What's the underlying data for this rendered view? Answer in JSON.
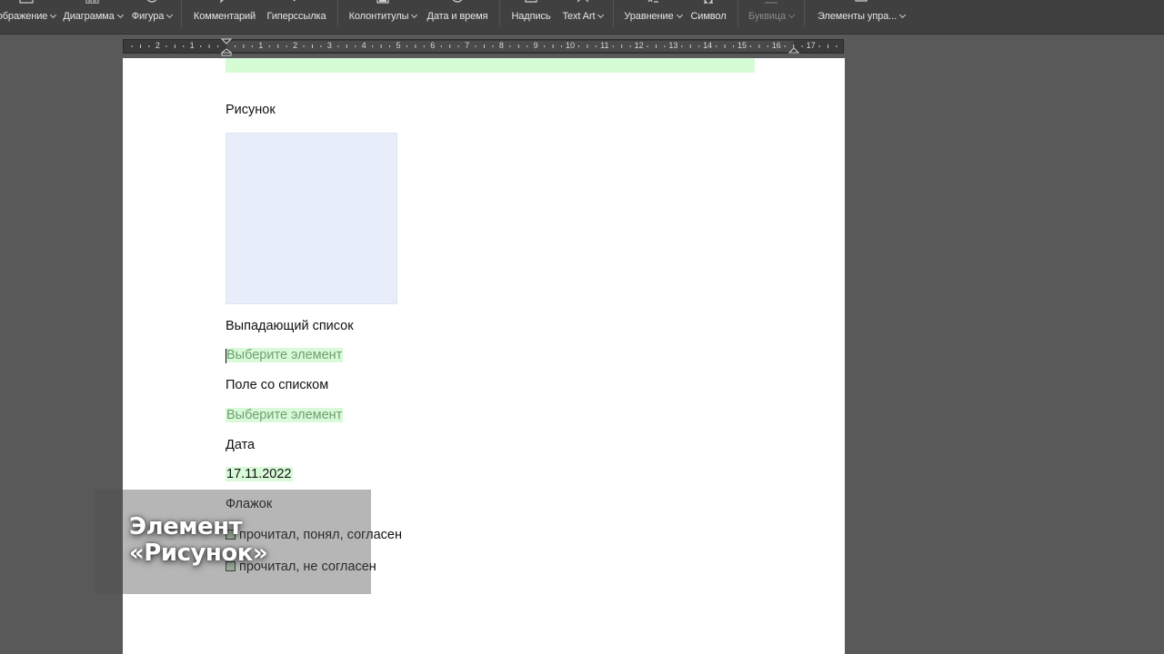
{
  "toolbar": {
    "items": [
      {
        "label": "ображение",
        "dropdown": true,
        "icon": "image-icon"
      },
      {
        "label": "Диаграмма",
        "dropdown": true,
        "icon": "chart-icon"
      },
      {
        "label": "Фигура",
        "dropdown": true,
        "icon": "shape-icon"
      },
      {
        "label": "Комментарий",
        "dropdown": false,
        "icon": "comment-icon"
      },
      {
        "label": "Гиперссылка",
        "dropdown": false,
        "icon": "hyperlink-icon"
      },
      {
        "label": "Колонтитулы",
        "dropdown": true,
        "icon": "header-footer-icon"
      },
      {
        "label": "Дата и время",
        "dropdown": false,
        "icon": "date-time-icon"
      },
      {
        "label": "Надпись",
        "dropdown": false,
        "icon": "text-box-icon"
      },
      {
        "label": "Text Art",
        "dropdown": true,
        "icon": "text-art-icon"
      },
      {
        "label": "Уравнение",
        "dropdown": true,
        "icon": "equation-icon"
      },
      {
        "label": "Символ",
        "dropdown": false,
        "icon": "symbol-icon"
      },
      {
        "label": "Буквица",
        "dropdown": true,
        "icon": "drop-cap-icon",
        "disabled": true
      },
      {
        "label": "Элементы упра...",
        "dropdown": true,
        "icon": "content-controls-icon"
      }
    ]
  },
  "ruler": {
    "numbers": [
      "2",
      "1",
      "1",
      "2",
      "3",
      "4",
      "5",
      "6",
      "7",
      "8",
      "9",
      "10",
      "11",
      "12",
      "13",
      "14",
      "15",
      "16",
      "17"
    ]
  },
  "document": {
    "picture_label": "Рисунок",
    "dropdown_label": "Выпадающий список",
    "dropdown_placeholder": "Выберите элемент",
    "combobox_label": "Поле со списком",
    "combobox_placeholder": "Выберите элемент",
    "date_label": "Дата",
    "date_value": "17.11.2022",
    "checkbox_label": "Флажок",
    "checkbox_1": "прочитал, понял, согласен",
    "checkbox_2": "прочитал, не согласен"
  },
  "overlay": {
    "line1": "Элемент",
    "line2": "«Рисунок»"
  },
  "colors": {
    "content_control_bg": "#d9fad9",
    "picture_placeholder_bg": "#e8eef9",
    "toolbar_bg": "#404040",
    "workspace_bg": "#595959"
  }
}
